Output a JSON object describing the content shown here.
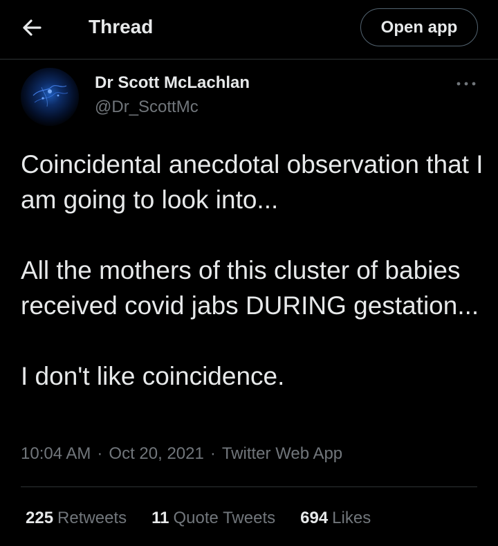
{
  "header": {
    "back_icon": "arrow-left-icon",
    "title": "Thread",
    "open_app_label": "Open app"
  },
  "tweet": {
    "author_name": "Dr Scott McLachlan",
    "author_handle": "@Dr_ScottMc",
    "more_icon": "more-horizontal-icon",
    "paragraphs": [
      "Coincidental anecdotal observation that I am going to look into...",
      "All the mothers of this cluster of babies received covid jabs DURING gestation...",
      "I don't like coincidence."
    ],
    "time": "10:04 AM",
    "date": "Oct 20, 2021",
    "source": "Twitter Web App",
    "separator": "·"
  },
  "stats": [
    {
      "count": "225",
      "label": "Retweets"
    },
    {
      "count": "11",
      "label": "Quote Tweets"
    },
    {
      "count": "694",
      "label": "Likes"
    }
  ],
  "colors": {
    "background": "#000000",
    "text_primary": "#e7e9ea",
    "text_secondary": "#71767b",
    "divider": "#2f3336"
  }
}
